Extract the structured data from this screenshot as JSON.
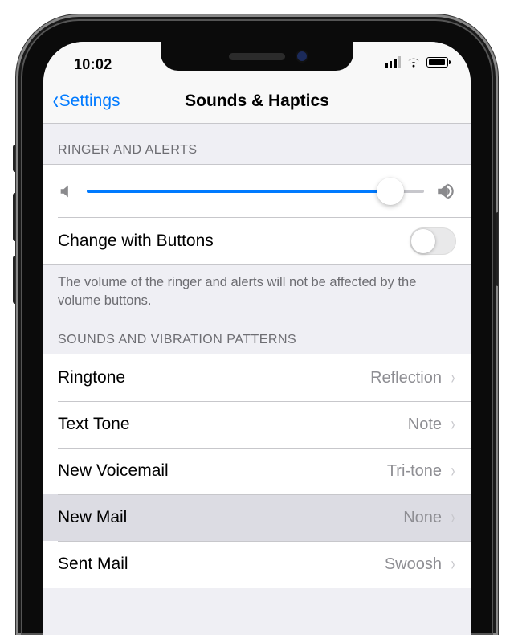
{
  "status": {
    "time": "10:02"
  },
  "nav": {
    "back_label": "Settings",
    "title": "Sounds & Haptics"
  },
  "ringer": {
    "header": "RINGER AND ALERTS",
    "slider_value": 0.9,
    "change_buttons_label": "Change with Buttons",
    "change_buttons_on": false,
    "footer": "The volume of the ringer and alerts will not be affected by the volume buttons."
  },
  "patterns": {
    "header": "SOUNDS AND VIBRATION PATTERNS",
    "items": [
      {
        "label": "Ringtone",
        "value": "Reflection",
        "selected": false
      },
      {
        "label": "Text Tone",
        "value": "Note",
        "selected": false
      },
      {
        "label": "New Voicemail",
        "value": "Tri-tone",
        "selected": false
      },
      {
        "label": "New Mail",
        "value": "None",
        "selected": true
      },
      {
        "label": "Sent Mail",
        "value": "Swoosh",
        "selected": false
      }
    ]
  },
  "colors": {
    "tint": "#007aff",
    "secondary": "#8e8e93",
    "separator": "#c7c7cb",
    "group_bg": "#efeff4"
  }
}
